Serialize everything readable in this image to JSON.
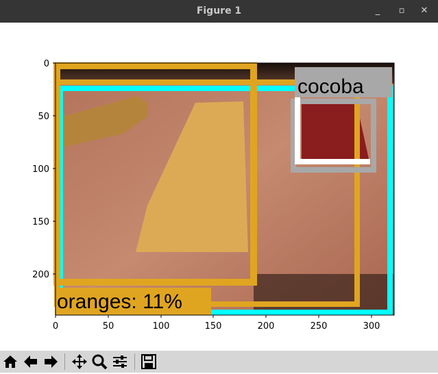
{
  "window": {
    "title": "Figure 1",
    "controls": [
      "minimize-icon",
      "maximize-icon",
      "close-icon"
    ]
  },
  "plot": {
    "x_ticks": [
      "0",
      "50",
      "100",
      "150",
      "200",
      "250",
      "300"
    ],
    "y_ticks": [
      "0",
      "50",
      "100",
      "150",
      "200"
    ],
    "detections": [
      {
        "label": "oranges: 11%",
        "color": "#e0a520"
      },
      {
        "label": "cocoba",
        "color": "#a8a8a8"
      }
    ],
    "box_colors": {
      "cyan": "#00ffff",
      "gold": "#e0a520",
      "gray": "#a8a8a8",
      "white": "#ffffff"
    }
  },
  "toolbar": {
    "tools": [
      {
        "name": "home-icon",
        "tooltip": "Reset original view"
      },
      {
        "name": "back-arrow-icon",
        "tooltip": "Back"
      },
      {
        "name": "forward-arrow-icon",
        "tooltip": "Forward"
      },
      {
        "name": "pan-icon",
        "tooltip": "Pan"
      },
      {
        "name": "zoom-icon",
        "tooltip": "Zoom"
      },
      {
        "name": "configure-subplots-icon",
        "tooltip": "Configure subplots"
      },
      {
        "name": "save-icon",
        "tooltip": "Save"
      }
    ]
  }
}
